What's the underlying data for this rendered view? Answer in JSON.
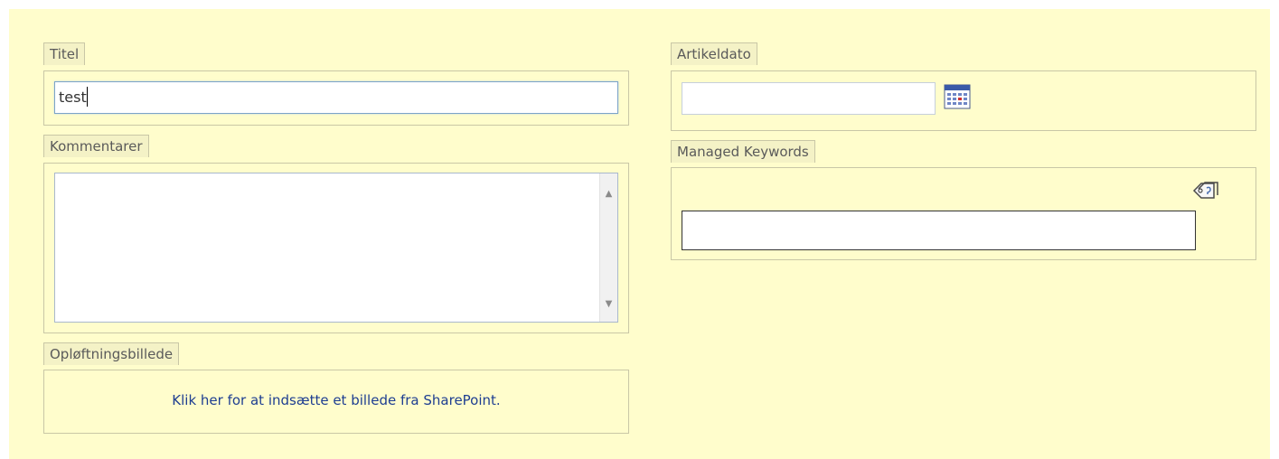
{
  "form": {
    "titel": {
      "label": "Titel",
      "value": "test"
    },
    "kommentarer": {
      "label": "Kommentarer",
      "value": ""
    },
    "oploeftningsbillede": {
      "label": "Opløftningsbillede",
      "link_text": "Klik her for at indsætte et billede fra SharePoint."
    },
    "artikeldato": {
      "label": "Artikeldato",
      "value": "",
      "icon": "calendar-icon"
    },
    "managed_keywords": {
      "label": "Managed Keywords",
      "value": "",
      "icon": "tags-icon"
    }
  },
  "colors": {
    "panel_background": "#fffdcc",
    "link": "#1e3e91",
    "border": "#c9c7a6"
  }
}
